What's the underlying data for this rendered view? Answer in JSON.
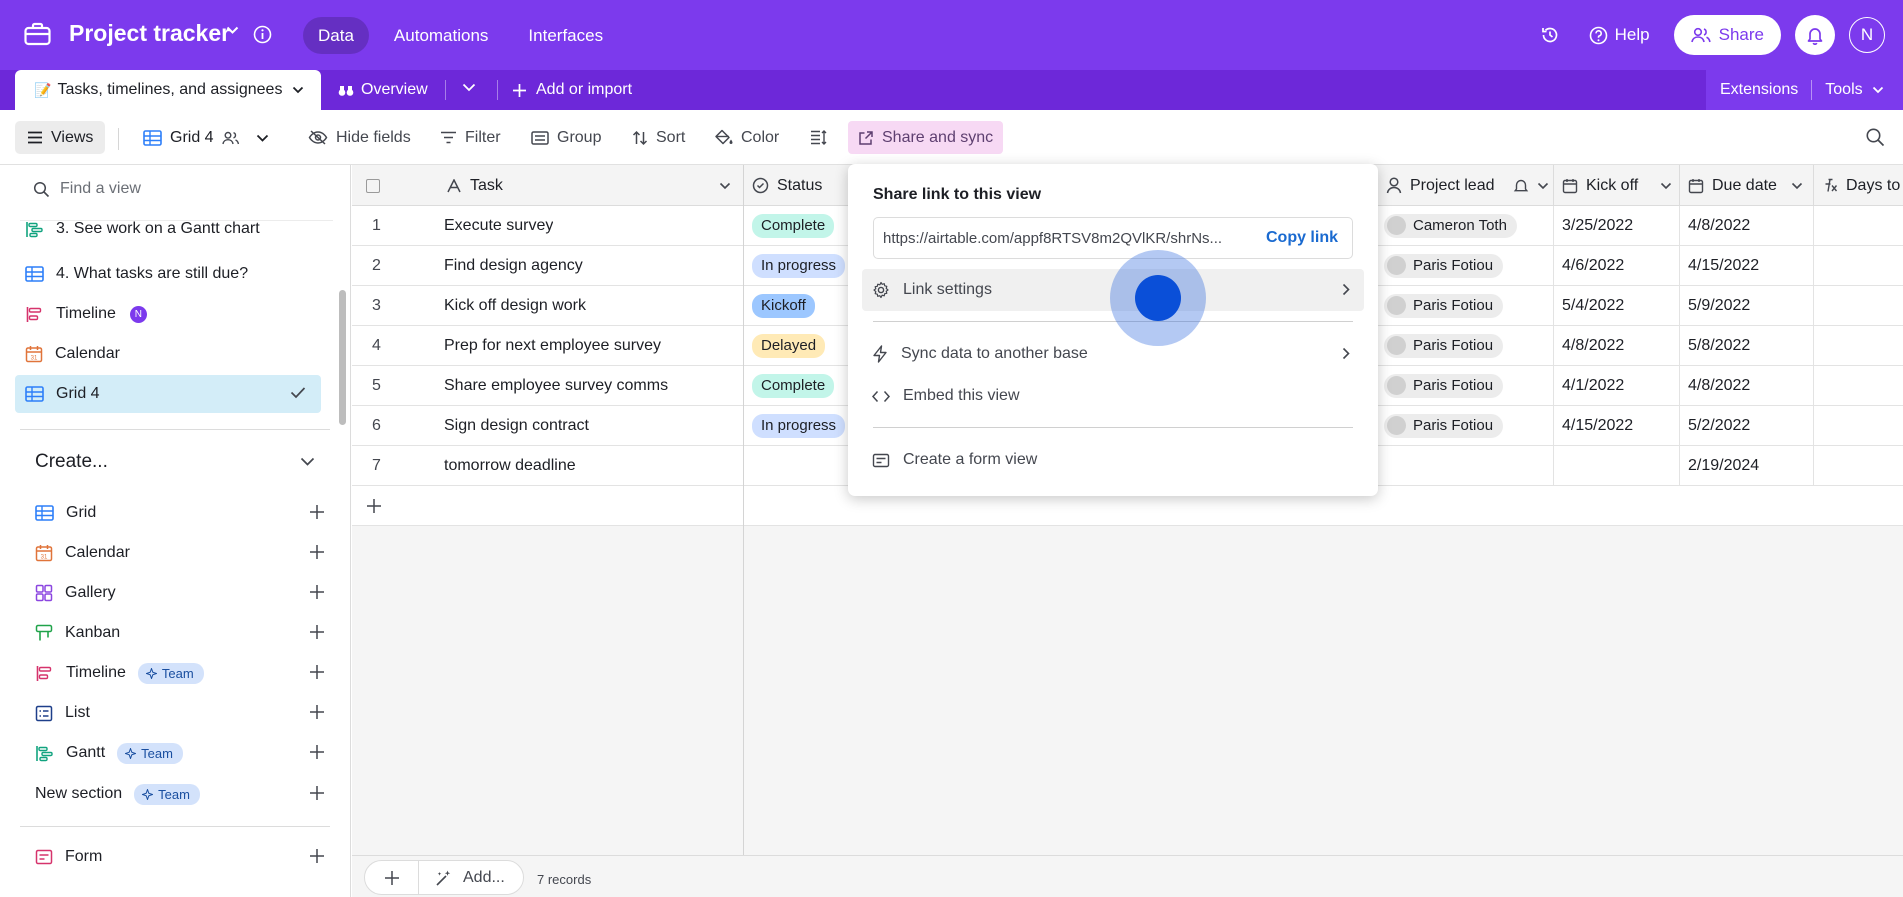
{
  "app": {
    "title": "Project tracker",
    "nav": [
      "Data",
      "Automations",
      "Interfaces"
    ],
    "help_label": "Help",
    "share_label": "Share",
    "avatar_initial": "N",
    "accent_color": "#7c3aed"
  },
  "tables": {
    "active_table": "Tasks, timelines, and assignees",
    "overview_label": "Overview",
    "add_import_label": "Add or import",
    "extensions_label": "Extensions",
    "tools_label": "Tools"
  },
  "toolbar": {
    "views_label": "Views",
    "current_view": "Grid 4",
    "hide_fields": "Hide fields",
    "filter": "Filter",
    "group": "Group",
    "sort": "Sort",
    "color": "Color",
    "share_sync": "Share and sync"
  },
  "sidebar": {
    "find_placeholder": "Find a view",
    "views": [
      {
        "label": "3. See work on a Gantt chart",
        "icon": "gantt-icon"
      },
      {
        "label": "4. What tasks are still due?",
        "icon": "grid-icon"
      },
      {
        "label": "Timeline",
        "icon": "timeline-icon",
        "badge": "N"
      },
      {
        "label": "Calendar",
        "icon": "calendar-icon"
      },
      {
        "label": "Grid 4",
        "icon": "grid-icon",
        "active": true
      }
    ],
    "create_label": "Create...",
    "create_items": [
      {
        "label": "Grid",
        "icon": "grid-icon"
      },
      {
        "label": "Calendar",
        "icon": "calendar-icon"
      },
      {
        "label": "Gallery",
        "icon": "gallery-icon"
      },
      {
        "label": "Kanban",
        "icon": "kanban-icon"
      },
      {
        "label": "Timeline",
        "icon": "timeline-icon",
        "team": "Team"
      },
      {
        "label": "List",
        "icon": "list-icon"
      },
      {
        "label": "Gantt",
        "icon": "gantt-icon",
        "team": "Team"
      },
      {
        "label": "New section",
        "team": "Team"
      },
      {
        "label": "Form",
        "icon": "form-icon"
      }
    ]
  },
  "grid": {
    "columns": {
      "task": "Task",
      "status": "Status",
      "project_lead": "Project lead",
      "kick_off": "Kick off",
      "due_date": "Due date",
      "days_to": "Days to"
    },
    "rows": [
      {
        "num": "1",
        "task": "Execute survey",
        "status": "Complete",
        "lead": "Cameron Toth",
        "kickoff": "3/25/2022",
        "due": "4/8/2022"
      },
      {
        "num": "2",
        "task": "Find design agency",
        "status": "In progress",
        "lead": "Paris Fotiou",
        "kickoff": "4/6/2022",
        "due": "4/15/2022"
      },
      {
        "num": "3",
        "task": "Kick off design work",
        "status": "Kickoff",
        "lead": "Paris Fotiou",
        "kickoff": "5/4/2022",
        "due": "5/9/2022"
      },
      {
        "num": "4",
        "task": "Prep for next employee survey",
        "status": "Delayed",
        "lead": "Paris Fotiou",
        "kickoff": "4/8/2022",
        "due": "5/8/2022"
      },
      {
        "num": "5",
        "task": "Share employee survey comms",
        "status": "Complete",
        "lead": "Paris Fotiou",
        "kickoff": "4/1/2022",
        "due": "4/8/2022"
      },
      {
        "num": "6",
        "task": "Sign design contract",
        "status": "In progress",
        "lead": "Paris Fotiou",
        "kickoff": "4/15/2022",
        "due": "5/2/2022"
      },
      {
        "num": "7",
        "task": "tomorrow deadline",
        "status": "",
        "lead": "",
        "kickoff": "",
        "due": "2/19/2024"
      }
    ],
    "status_colors": {
      "Complete": "#c2f5e9",
      "In progress": "#cfdfff",
      "Kickoff": "#9cc7ff",
      "Delayed": "#ffeab6"
    },
    "footer_add_label": "Add...",
    "record_count": "7 records"
  },
  "popover": {
    "title": "Share link to this view",
    "url": "https://airtable.com/appf8RTSV8m2QVlKR/shrNs...",
    "copy_label": "Copy link",
    "items": {
      "link_settings": "Link settings",
      "sync": "Sync data to another base",
      "embed": "Embed this view",
      "form": "Create a form view"
    }
  }
}
